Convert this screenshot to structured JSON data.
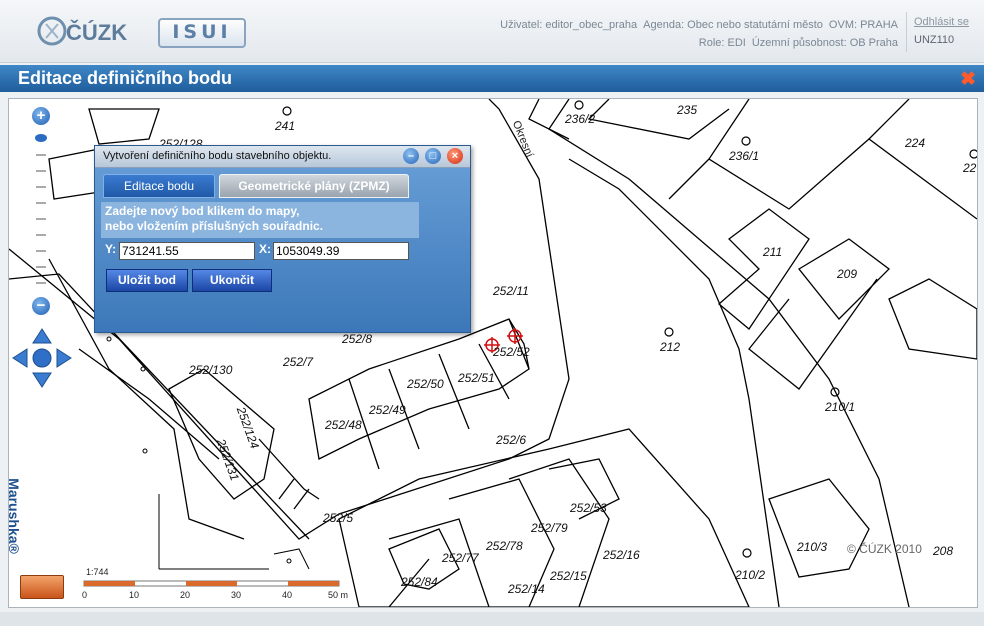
{
  "header": {
    "logo_cuzk": "ČÚZK",
    "logo_isui": "ISUI",
    "user": "Uživatel: editor_obec_praha",
    "agenda": "Agenda: Obec nebo statutární město",
    "ovm": "OVM: PRAHA",
    "role": "Role: EDI",
    "uzemni": "Územní působnost: OB Praha",
    "logout": "Odhlásit se",
    "code": "UNZ110"
  },
  "window": {
    "title": "Editace definičního bodu",
    "close_label": "✖"
  },
  "dialog": {
    "title": "Vytvoření definičního bodu stavebního objektu.",
    "tabs": [
      {
        "label": "Editace bodu",
        "active": true
      },
      {
        "label": "Geometrické plány (ZPMZ)",
        "active": false
      }
    ],
    "info_line1": "Zadejte nový bod klikem do mapy,",
    "info_line2": "nebo vložením příslušných souřadnic.",
    "y_label": "Y:",
    "y_value": "731241.55",
    "x_label": "X:",
    "x_value": "1053049.39",
    "save_button": "Uložit bod",
    "end_button": "Ukončit"
  },
  "map": {
    "parcels": [
      "241",
      "236/2",
      "235",
      "236/1",
      "224",
      "22",
      "211",
      "209",
      "252/11",
      "252/8",
      "252/52",
      "212",
      "252/7",
      "252/50",
      "252/51",
      "252/130",
      "252/49",
      "252/48",
      "210/1",
      "252/124",
      "252/131",
      "252/6",
      "252/5",
      "252/53",
      "252/79",
      "252/78",
      "252/77",
      "252/16",
      "252/84",
      "252/15",
      "252/14",
      "210/3",
      "210/2",
      "208",
      "252/128"
    ],
    "street": "Okresní",
    "copyright": "© ČÚZK 2010",
    "maruska": "Marushka®",
    "scale": {
      "ratio": "1:744",
      "ticks": [
        "0",
        "10",
        "20",
        "30",
        "40",
        "50 m"
      ]
    }
  },
  "colors": {
    "accent": "#2a6bb0",
    "scale_orange": "#d96a2b",
    "close_red": "#ff5a2a"
  }
}
